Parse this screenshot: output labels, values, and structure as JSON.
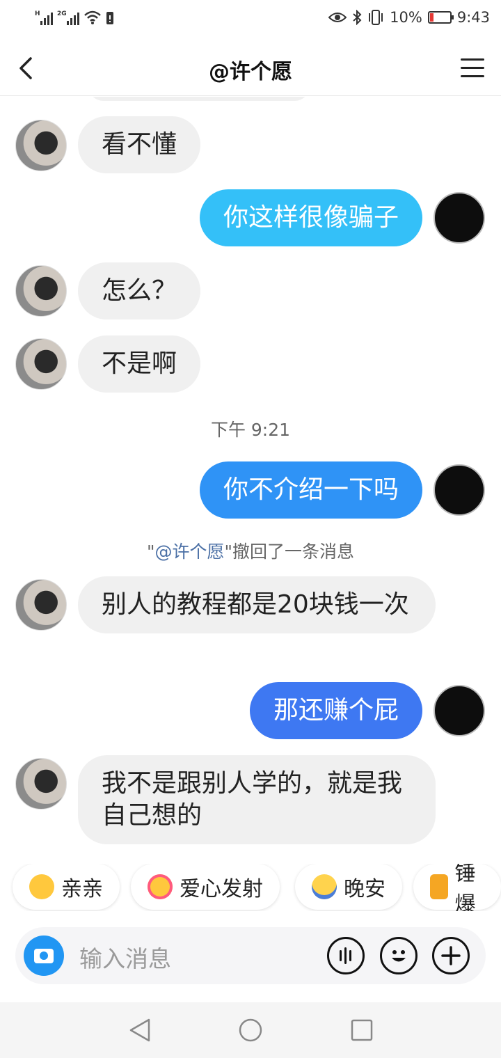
{
  "status_bar": {
    "sim1_label": "H",
    "sim2_label": "2G",
    "battery_percent": "10%",
    "time": "9:43",
    "icons": [
      "eye-icon",
      "bluetooth-icon",
      "vibrate-icon",
      "battery-icon",
      "wifi-icon",
      "sim-card-icon"
    ]
  },
  "header": {
    "title": "@许个愿",
    "back_icon": "back-arrow-icon",
    "menu_icon": "menu-icon"
  },
  "messages": [
    {
      "from": "them",
      "text": "看不懂"
    },
    {
      "from": "me",
      "text": "你这样很像骗子",
      "color": "#34c0f8"
    },
    {
      "from": "them",
      "text": "怎么？"
    },
    {
      "from": "them",
      "text": "不是啊"
    },
    {
      "from": "me",
      "text": "你不介绍一下吗",
      "color": "#2f93f6"
    },
    {
      "from": "them",
      "text": "别人的教程都是20块钱一次"
    },
    {
      "from": "me",
      "text": "那还赚个屁",
      "color": "#3e78f2"
    },
    {
      "from": "them",
      "text": "我不是跟别人学的，就是我自己想的"
    }
  ],
  "timestamp": "下午 9:21",
  "recall_notice": {
    "quote_open": "\"",
    "name": "@许个愿",
    "quote_close": "\"",
    "text": "撤回了一条消息"
  },
  "quick_reactions": [
    {
      "label": "亲亲",
      "icon": "kiss-emoji-icon"
    },
    {
      "label": "爱心发射",
      "icon": "heart-eyes-emoji-icon"
    },
    {
      "label": "晚安",
      "icon": "sleeping-emoji-icon"
    },
    {
      "label": "锤爆",
      "icon": "hammer-emoji-icon"
    }
  ],
  "input": {
    "placeholder": "输入消息",
    "camera_icon": "camera-icon",
    "voice_icon": "voice-icon",
    "emoji_icon": "emoji-icon",
    "plus_icon": "plus-icon"
  },
  "colors": {
    "incoming_bubble": "#f0f0f0",
    "accent": "#2196f3"
  }
}
